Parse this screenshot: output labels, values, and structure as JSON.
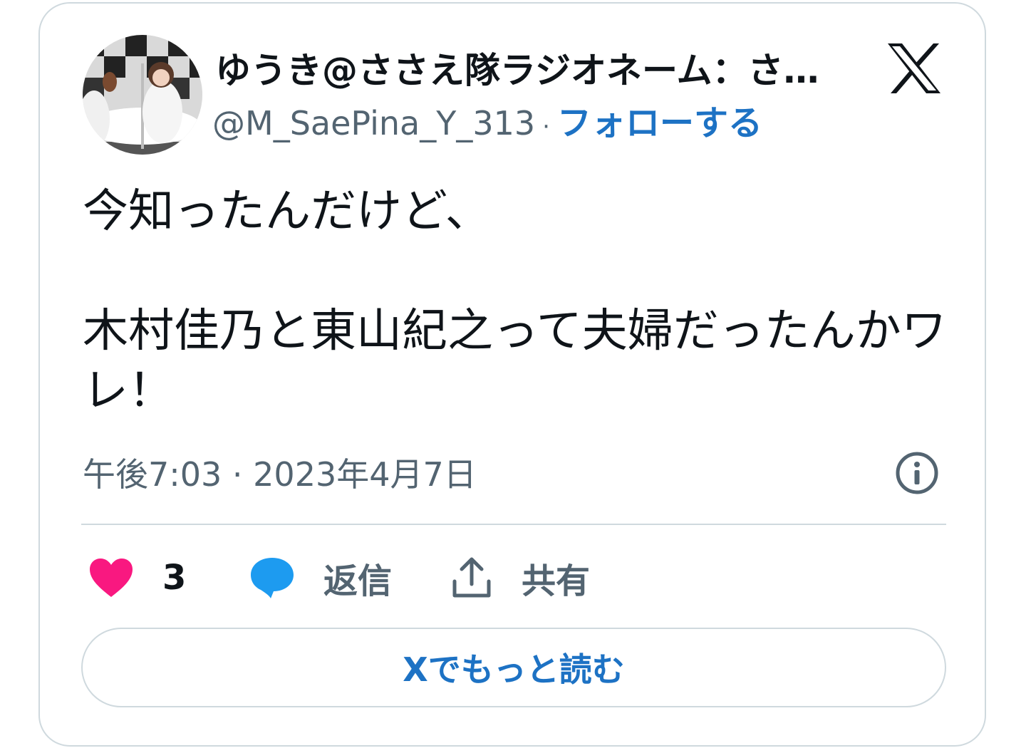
{
  "tweet": {
    "author_name": "ゆうき@ささえ隊ラジオネーム：さ…",
    "author_handle": "@M_SaePina_Y_313",
    "separator": "·",
    "follow_label": "フォローする",
    "text": "今知ったんだけど、\n\n木村佳乃と東山紀之って夫婦だったんかワレ！",
    "timestamp": "午後7:03 · 2023年4月7日"
  },
  "actions": {
    "like_count": "3",
    "reply_label": "返信",
    "share_label": "共有"
  },
  "footer": {
    "read_more_label": "Xでもっと読む"
  },
  "icons": {
    "like": "heart-icon",
    "reply": "speech-bubble-icon",
    "share": "upload-arrow-icon",
    "info": "info-icon",
    "logo": "x-logo-icon"
  },
  "colors": {
    "like": "#f91880",
    "reply": "#1d9bf0",
    "link": "#1d72c4",
    "muted": "#536471",
    "border": "#cfd9de"
  }
}
